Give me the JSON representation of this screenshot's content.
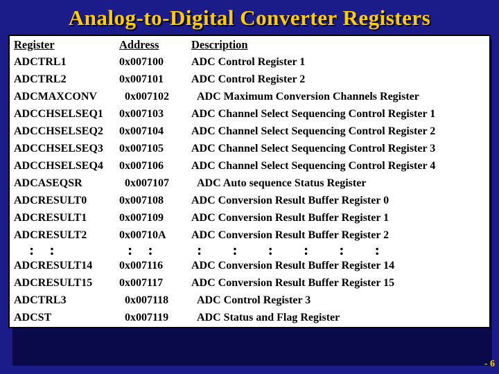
{
  "title": "Analog-to-Digital Converter Registers",
  "headers": {
    "register": "Register",
    "address": "Address",
    "description": "Description"
  },
  "rows": [
    {
      "reg": "ADCTRL1",
      "addr": "0x007100",
      "desc": "ADC Control Register 1"
    },
    {
      "reg": "ADCTRL2",
      "addr": "0x007101",
      "desc": "ADC Control Register 2"
    },
    {
      "reg": "ADCMAXCONV",
      "addr": "0x007102",
      "desc": "ADC Maximum Conversion Channels Register",
      "indent": true
    },
    {
      "reg": "ADCCHSELSEQ1",
      "addr": "0x007103",
      "desc": "ADC Channel Select Sequencing Control Register 1"
    },
    {
      "reg": "ADCCHSELSEQ2",
      "addr": "0x007104",
      "desc": "ADC Channel Select Sequencing Control Register 2"
    },
    {
      "reg": "ADCCHSELSEQ3",
      "addr": "0x007105",
      "desc": "ADC Channel Select Sequencing Control Register 3"
    },
    {
      "reg": "ADCCHSELSEQ4",
      "addr": "0x007106",
      "desc": "ADC Channel Select Sequencing Control Register 4"
    },
    {
      "reg": "ADCASEQSR",
      "addr": "0x007107",
      "desc": "ADC Auto sequence Status Register",
      "indent": true
    },
    {
      "reg": "ADCRESULT0",
      "addr": "0x007108",
      "desc": "ADC Conversion Result Buffer Register 0"
    },
    {
      "reg": "ADCRESULT1",
      "addr": "0x007109",
      "desc": "ADC Conversion Result Buffer Register 1"
    },
    {
      "reg": "ADCRESULT2",
      "addr": "0x00710A",
      "desc": "ADC Conversion Result Buffer Register 2"
    },
    {
      "ellipsis": true
    },
    {
      "reg": "ADCRESULT14",
      "addr": "0x007116",
      "desc": "ADC Conversion Result Buffer Register 14"
    },
    {
      "reg": "ADCRESULT15",
      "addr": "0x007117",
      "desc": "ADC Conversion Result Buffer Register 15"
    },
    {
      "reg": "ADCTRL3",
      "addr": "0x007118",
      "desc": "ADC Control Register 3",
      "indent": true
    },
    {
      "reg": "ADCST",
      "addr": "0x007119",
      "desc": "ADC Status and Flag Register",
      "indent": true
    }
  ],
  "ellipsis_glyphs": {
    "c1": "::",
    "c2": "::",
    "c3": "::::::"
  },
  "page_number": "- 6"
}
